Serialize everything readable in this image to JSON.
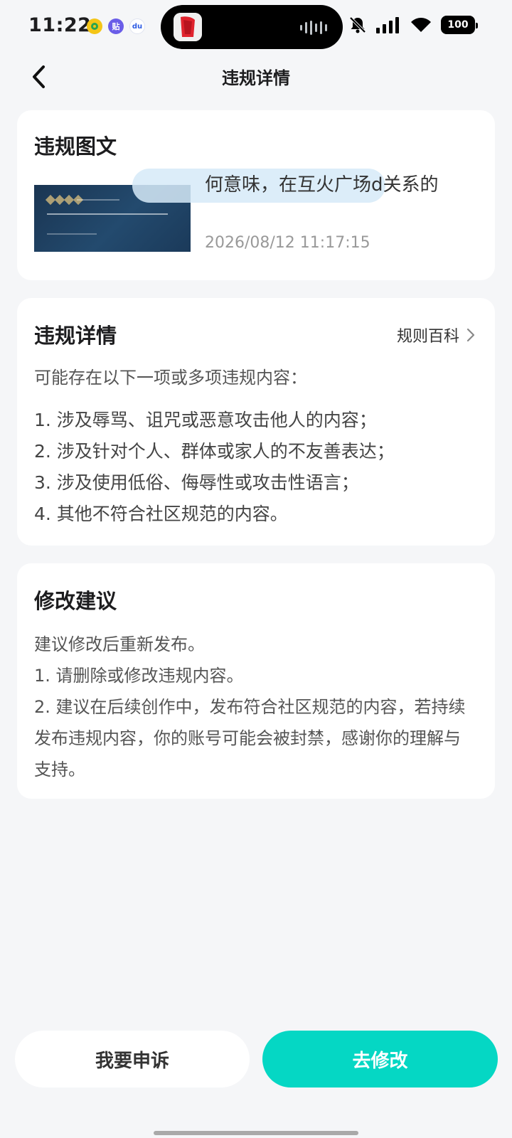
{
  "status_bar": {
    "time": "11:22",
    "battery": "100",
    "tieba_glyph": "贴",
    "baidu_glyph": "du"
  },
  "header": {
    "title": "违规详情"
  },
  "post_card": {
    "title": "违规图文",
    "post_text": "何意味，在互火广场d关系的",
    "timestamp": "2026/08/12 11:17:15"
  },
  "violation_card": {
    "title": "违规详情",
    "rules_link": "规则百科",
    "intro": "可能存在以下一项或多项违规内容：",
    "items": [
      "1. 涉及辱骂、诅咒或恶意攻击他人的内容；",
      "2. 涉及针对个人、群体或家人的不友善表达；",
      "3. 涉及使用低俗、侮辱性或攻击性语言；",
      "4. 其他不符合社区规范的内容。"
    ]
  },
  "suggestion_card": {
    "title": "修改建议",
    "lines": [
      "建议修改后重新发布。",
      "1. 请删除或修改违规内容。",
      "2. 建议在后续创作中，发布符合社区规范的内容，若持续发布违规内容，你的账号可能会被封禁，感谢你的理解与支持。"
    ]
  },
  "actions": {
    "appeal": "我要申诉",
    "modify": "去修改"
  },
  "colors": {
    "accent": "#05d7c4",
    "background": "#f5f6f8",
    "card": "#ffffff"
  }
}
